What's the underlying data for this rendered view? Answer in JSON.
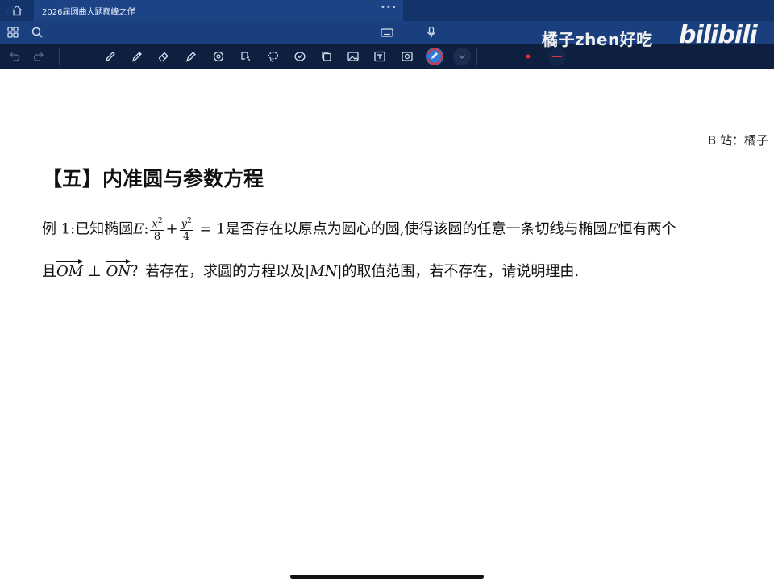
{
  "app": {
    "tab_title": "2026届圆曲大题巅峰之作",
    "tab_more": "•••"
  },
  "toolbar_row1": {
    "icons": [
      "grid-icon",
      "search-icon",
      "pen-mode-icon",
      "keyboard-icon",
      "microphone-icon"
    ]
  },
  "toolbar_row2": {
    "icons": [
      "undo-icon",
      "redo-icon",
      "pen-icon",
      "pencil-icon",
      "eraser-icon",
      "highlighter-icon",
      "shape-icon",
      "lasso-select-icon",
      "lasso-icon",
      "sticker-icon",
      "copy-icon",
      "image-icon",
      "text-icon",
      "camera-icon",
      "color-icon",
      "dropdown-icon"
    ],
    "colors": {
      "accent_red": "#d9343a",
      "accent_blue": "#2f7ad8",
      "dark": "#0f1f3f"
    }
  },
  "watermark": {
    "text": "橘子zhen好吃",
    "logo": "bilibili"
  },
  "document": {
    "header_right": "B 站：橘子",
    "section_title": "【五】内准圆与参数方程",
    "line1": {
      "prefix": "例 1:已知椭圆",
      "ellipse_name": "E",
      "colon": ":",
      "frac1_num": "x",
      "frac1_den": "8",
      "plus": "+",
      "frac2_num": "y",
      "frac2_den": "4",
      "equals": "= 1",
      "middle": "是否存在以原点为圆心的圆,使得该圆的任意一条切线与椭圆",
      "ellipse_name2": "E",
      "suffix": "恒有两个"
    },
    "line2": {
      "prefix": "且",
      "vec1": "OM",
      "perp": " ⊥ ",
      "vec2": "ON",
      "middle": "？若存在，求圆的方程以及",
      "abs": "|MN|",
      "suffix": "的取值范围，若不存在，请说明理由."
    }
  }
}
